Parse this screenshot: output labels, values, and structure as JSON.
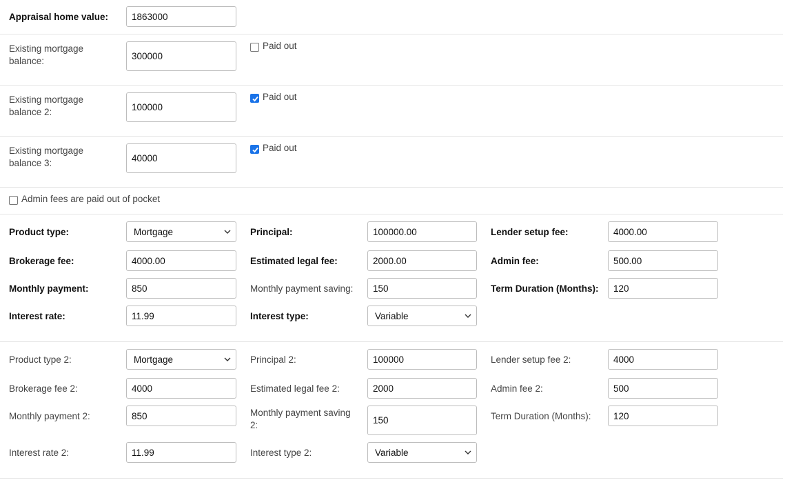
{
  "appraisal": {
    "label": "Appraisal home value:",
    "value": "1863000"
  },
  "mortgages": [
    {
      "label": "Existing mortgage balance:",
      "value": "300000",
      "paid_label": "Paid out",
      "paid": false
    },
    {
      "label": "Existing mortgage balance 2:",
      "value": "100000",
      "paid_label": "Paid out",
      "paid": true
    },
    {
      "label": "Existing mortgage balance 3:",
      "value": "40000",
      "paid_label": "Paid out",
      "paid": true
    }
  ],
  "admin_pocket": {
    "label": "Admin fees are paid out of pocket",
    "checked": false
  },
  "product1": {
    "product_type": {
      "label": "Product type:",
      "value": "Mortgage"
    },
    "principal": {
      "label": "Principal:",
      "value": "100000.00"
    },
    "lender_fee": {
      "label": "Lender setup fee:",
      "value": "4000.00"
    },
    "brokerage_fee": {
      "label": "Brokerage fee:",
      "value": "4000.00"
    },
    "legal_fee": {
      "label": "Estimated legal fee:",
      "value": "2000.00"
    },
    "admin_fee": {
      "label": "Admin fee:",
      "value": "500.00"
    },
    "monthly_payment": {
      "label": "Monthly payment:",
      "value": "850"
    },
    "payment_saving": {
      "label": "Monthly payment saving:",
      "value": "150"
    },
    "term": {
      "label": "Term Duration (Months):",
      "value": "120"
    },
    "interest_rate": {
      "label": "Interest rate:",
      "value": "11.99"
    },
    "interest_type": {
      "label": "Interest type:",
      "value": "Variable"
    }
  },
  "product2": {
    "product_type": {
      "label": "Product type 2:",
      "value": "Mortgage"
    },
    "principal": {
      "label": "Principal 2:",
      "value": "100000"
    },
    "lender_fee": {
      "label": "Lender setup fee 2:",
      "value": "4000"
    },
    "brokerage_fee": {
      "label": "Brokerage fee 2:",
      "value": "4000"
    },
    "legal_fee": {
      "label": "Estimated legal fee 2:",
      "value": "2000"
    },
    "admin_fee": {
      "label": "Admin fee 2:",
      "value": "500"
    },
    "monthly_payment": {
      "label": "Monthly payment 2:",
      "value": "850"
    },
    "payment_saving": {
      "label": "Monthly payment saving 2:",
      "value": "150"
    },
    "term": {
      "label": "Term Duration (Months):",
      "value": "120"
    },
    "interest_rate": {
      "label": "Interest rate 2:",
      "value": "11.99"
    },
    "interest_type": {
      "label": "Interest type 2:",
      "value": "Variable"
    }
  }
}
